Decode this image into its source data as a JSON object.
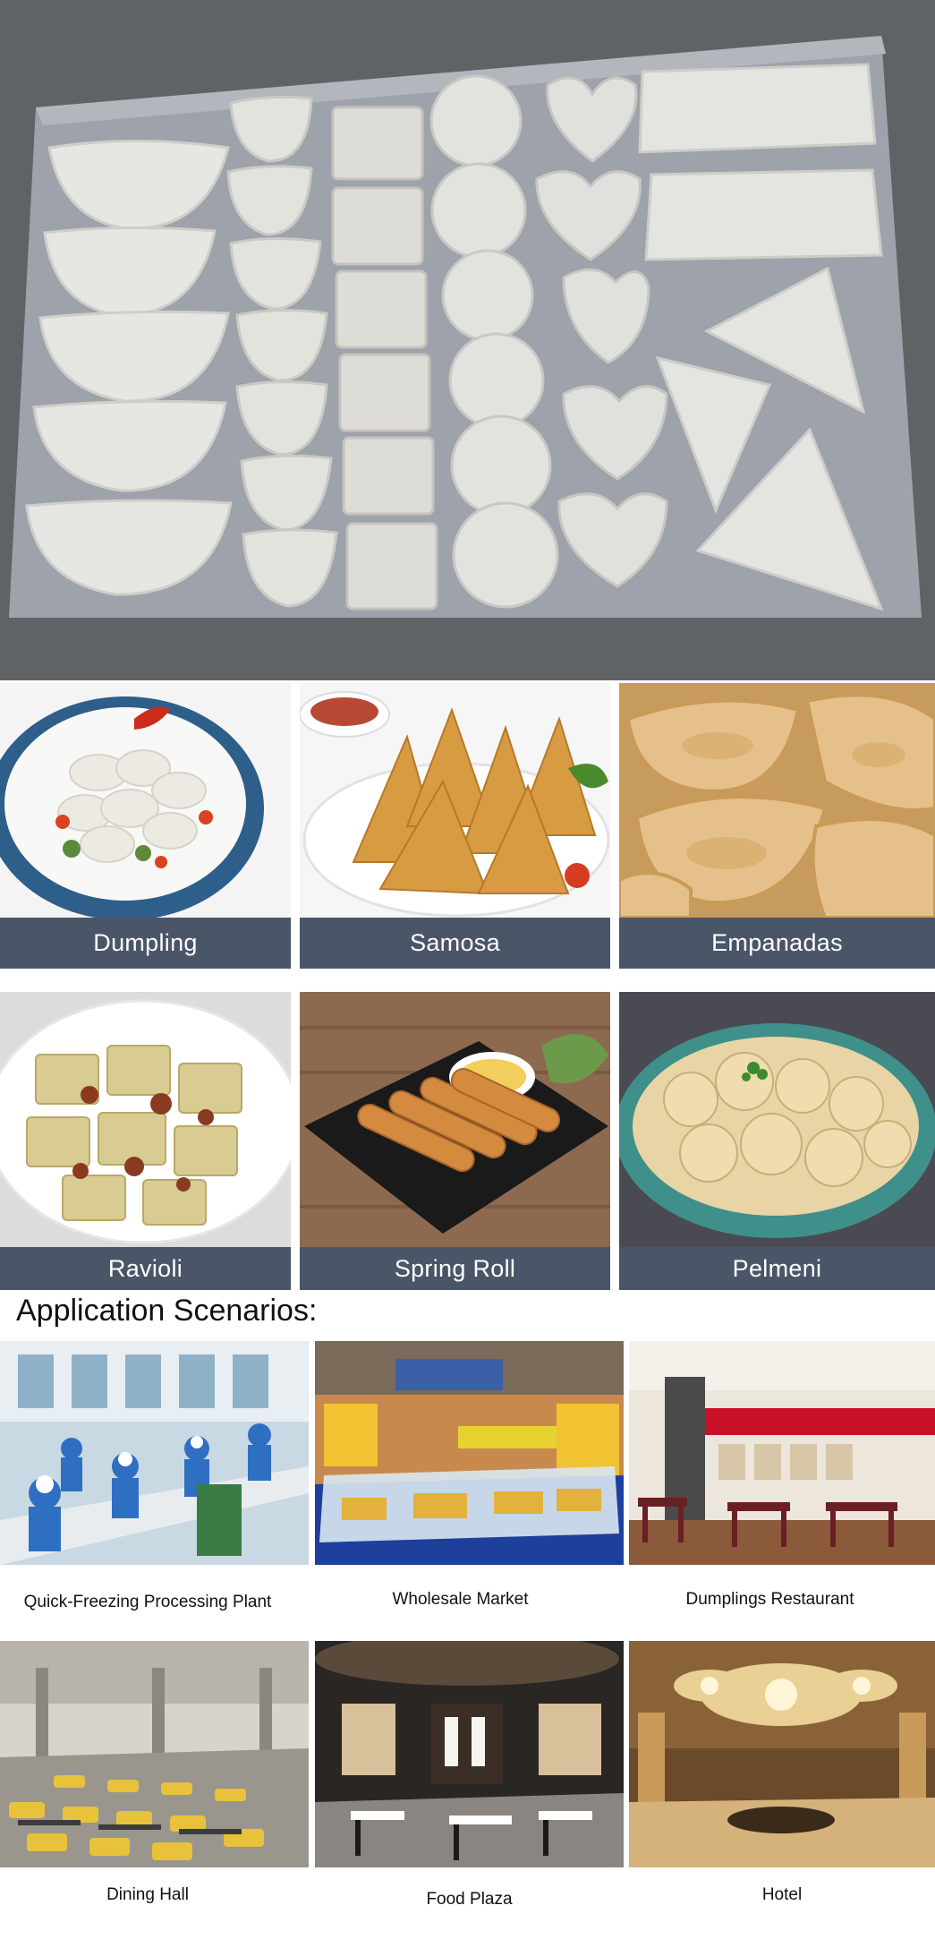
{
  "products": [
    {
      "label": "Dumpling"
    },
    {
      "label": "Samosa"
    },
    {
      "label": "Empanadas"
    },
    {
      "label": "Ravioli"
    },
    {
      "label": "Spring Roll"
    },
    {
      "label": "Pelmeni"
    }
  ],
  "scenarios_title": "Application Scenarios:",
  "scenarios": [
    {
      "label": "Quick-Freezing Processing Plant"
    },
    {
      "label": "Wholesale Market"
    },
    {
      "label": "Dumplings Restaurant"
    },
    {
      "label": "Dining Hall"
    },
    {
      "label": "Food Plaza"
    },
    {
      "label": "Hotel"
    }
  ],
  "colors": {
    "caption_bar": "#4b5568",
    "caption_text": "#ffffff",
    "tray": "#9ea2ab",
    "dough": "#e6e6e2"
  }
}
